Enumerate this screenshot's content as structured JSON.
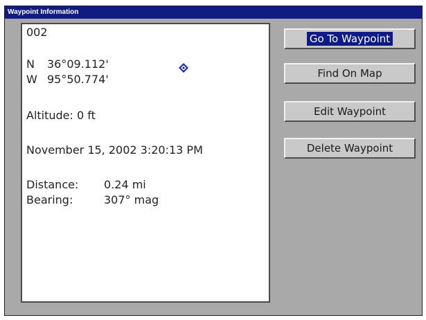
{
  "window": {
    "title": "Waypoint Information"
  },
  "waypoint": {
    "name": "002",
    "lat_hemisphere": "N",
    "lat_value": "36°09.112'",
    "lon_hemisphere": "W",
    "lon_value": "95°50.774'",
    "altitude": "Altitude: 0 ft",
    "timestamp": "November 15, 2002 3:20:13 PM",
    "distance_label": "Distance:",
    "distance_value": "0.24 mi",
    "bearing_label": "Bearing:",
    "bearing_value": "307° mag",
    "icon": "waypoint-diamond-icon"
  },
  "buttons": {
    "go_to": "Go To Waypoint",
    "find_on_map": "Find On Map",
    "edit": "Edit Waypoint",
    "delete": "Delete Waypoint"
  },
  "colors": {
    "titlebar": "#101c82",
    "selected": "#0e1a86",
    "window_bg": "#a9a9a9",
    "icon": "#1a2a9a"
  }
}
